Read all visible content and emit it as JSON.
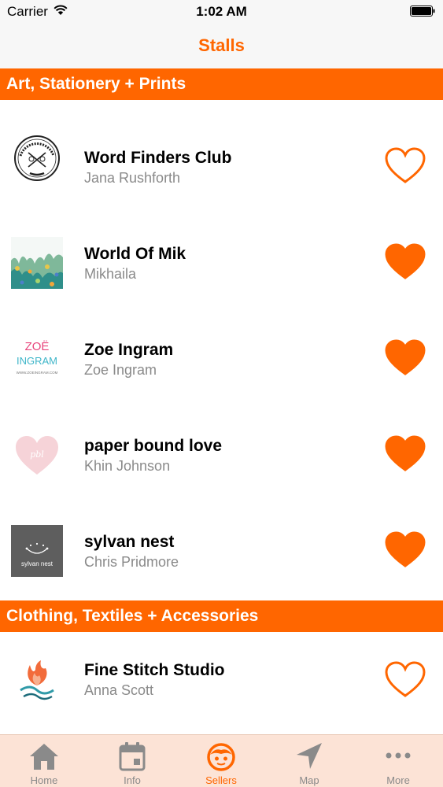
{
  "status_bar": {
    "carrier": "Carrier",
    "time": "1:02 AM"
  },
  "nav": {
    "title": "Stalls"
  },
  "colors": {
    "accent": "#ff6600",
    "tab_bar_bg": "#fce3d6",
    "inactive_icon": "#8a8a8a"
  },
  "sections": [
    {
      "header": "Art, Stationery + Prints",
      "items": [
        {
          "title": "Word Finders Club",
          "subtitle": "Jana Rushforth",
          "favorited": false,
          "thumb_icon": "word-finders-club-logo"
        },
        {
          "title": "World Of Mik",
          "subtitle": "Mikhaila",
          "favorited": true,
          "thumb_icon": "leafy-illustration"
        },
        {
          "title": "Zoe Ingram",
          "subtitle": "Zoe Ingram",
          "favorited": true,
          "thumb_icon": "zoe-ingram-logo",
          "thumb_text_1": "ZOË",
          "thumb_text_2": "INGRAM",
          "thumb_text_3": "WWW.ZOEINGRAM.COM"
        },
        {
          "title": "paper bound love",
          "subtitle": "Khin Johnson",
          "favorited": true,
          "thumb_icon": "pink-heart-logo",
          "thumb_text": "pbl"
        },
        {
          "title": "sylvan nest",
          "subtitle": "Chris Pridmore",
          "favorited": true,
          "thumb_icon": "sylvan-nest-logo",
          "thumb_text": "sylvan nest"
        }
      ]
    },
    {
      "header": "Clothing, Textiles + Accessories",
      "items": [
        {
          "title": "Fine Stitch Studio",
          "subtitle": "Anna Scott",
          "favorited": false,
          "thumb_icon": "fine-stitch-studio-logo"
        }
      ]
    }
  ],
  "tabs": [
    {
      "label": "Home",
      "icon": "home-icon",
      "active": false
    },
    {
      "label": "Info",
      "icon": "calendar-icon",
      "active": false
    },
    {
      "label": "Sellers",
      "icon": "sellers-face-icon",
      "active": true
    },
    {
      "label": "Map",
      "icon": "location-arrow-icon",
      "active": false
    },
    {
      "label": "More",
      "icon": "more-dots-icon",
      "active": false
    }
  ]
}
